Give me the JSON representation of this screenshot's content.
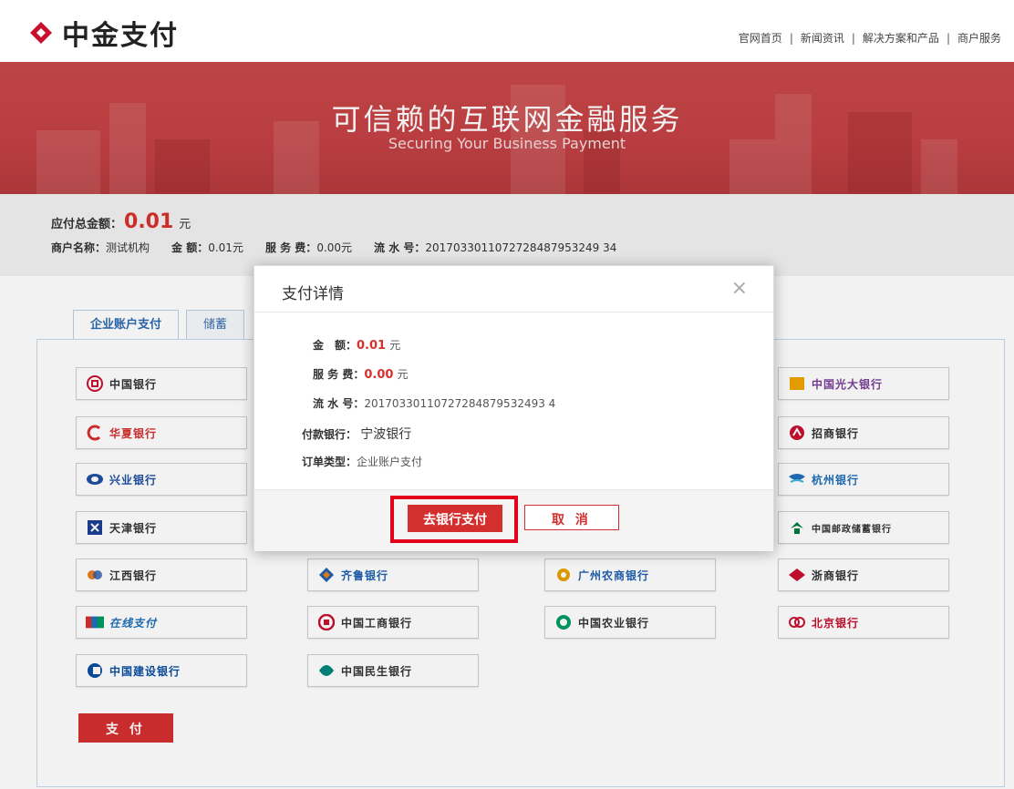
{
  "header": {
    "logo_text": "中金支付",
    "nav": [
      "官网首页",
      "新闻资讯",
      "解决方案和产品",
      "商户服务"
    ],
    "separator": "|"
  },
  "banner": {
    "title": "可信赖的互联网金融服务",
    "subtitle": "Securing Your Business Payment"
  },
  "summary": {
    "total_label": "应付总金额：",
    "total_value": "0.01",
    "total_unit": "元",
    "merchant_label": "商户名称：",
    "merchant_value": "测试机构",
    "amount_label": "金 额：",
    "amount_value": "0.01元",
    "fee_label": "服 务 费：",
    "fee_value": "0.00元",
    "serial_label": "流 水 号：",
    "serial_value": "2017033011072728487953249 34"
  },
  "tabs": [
    {
      "label": "企业账户支付"
    },
    {
      "label": "储蓄"
    }
  ],
  "banks": [
    {
      "name": "中国银行",
      "icon": "boc-icon",
      "color": "#c8102e"
    },
    {
      "name": "华夏银行",
      "icon": "hxb-icon",
      "color": "#d32f2f"
    },
    {
      "name": "兴业银行",
      "icon": "cib-icon",
      "color": "#1e4fa0"
    },
    {
      "name": "天津银行",
      "icon": "tjb-icon",
      "color": "#1c3f94"
    },
    {
      "name": "江西银行",
      "icon": "jxb-icon",
      "color": "#2a56a5"
    },
    {
      "name": "在线支付",
      "icon": "unionpay-icon",
      "color": "#1d6fb8"
    },
    {
      "name": "中国建设银行",
      "icon": "ccb-icon",
      "color": "#0b4fa2"
    },
    {
      "name": "齐鲁银行",
      "icon": "qlb-icon",
      "color": "#1f5fae"
    },
    {
      "name": "中国工商银行",
      "icon": "icbc-icon",
      "color": "#c8102e"
    },
    {
      "name": "中国民生银行",
      "icon": "cmbc-icon",
      "color": "#00857c"
    },
    {
      "name": "广州农商银行",
      "icon": "grcb-icon",
      "color": "#e6a100"
    },
    {
      "name": "中国农业银行",
      "icon": "abc-icon",
      "color": "#009a62"
    },
    {
      "name": "中国光大银行",
      "icon": "ceb-icon",
      "color": "#7a3e98"
    },
    {
      "name": "招商银行",
      "icon": "cmb-icon",
      "color": "#c8102e"
    },
    {
      "name": "杭州银行",
      "icon": "hzb-icon",
      "color": "#1f6fb8"
    },
    {
      "name": "中国邮政储蓄银行",
      "icon": "psbc-icon",
      "color": "#007a3d"
    },
    {
      "name": "浙商银行",
      "icon": "czb-icon",
      "color": "#c8102e"
    },
    {
      "name": "北京银行",
      "icon": "bob-icon",
      "color": "#c8102e"
    }
  ],
  "pay_button": "支 付",
  "modal": {
    "title": "支付详情",
    "close": "×",
    "amount_label": "金　额：",
    "amount_value": "0.01",
    "amount_unit": "元",
    "fee_label": "服 务 费：",
    "fee_value": "0.00",
    "fee_unit": "元",
    "serial_label": "流 水 号：",
    "serial_value": "20170330110727284879532493 4",
    "bank_label": "付款银行：",
    "bank_value": "宁波银行",
    "order_type_label": "订单类型：",
    "order_type_value": "企业账户支付",
    "go_bank_button": "去银行支付",
    "cancel_button": "取 消"
  }
}
